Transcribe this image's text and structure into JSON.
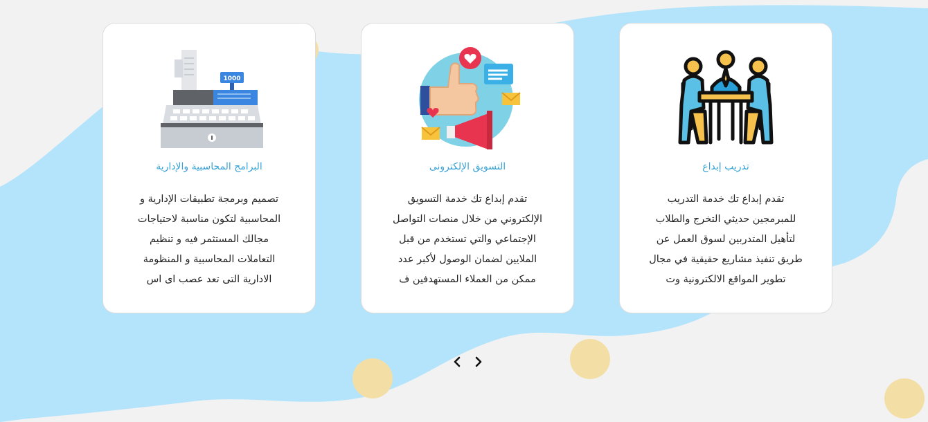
{
  "colors": {
    "background": "#f2f2f2",
    "blob": "#b3e4fb",
    "card": "#ffffff",
    "title": "#3aa3d6",
    "text": "#222222",
    "dot": "#f3dfa5"
  },
  "cards": [
    {
      "icon": "training-meeting-icon",
      "title": "تدريب إبداع",
      "lines": [
        "تقدم إبداع تك خدمة التدريب",
        "للمبرمجين حديثي التخرج والطلاب",
        "لتأهيل المتدربين لسوق العمل عن",
        "طريق تنفيذ مشاريع حقيقية في مجال",
        "تطوير المواقع الالكترونية وت"
      ]
    },
    {
      "icon": "digital-marketing-icon",
      "title": "التسويق الإلكترونى",
      "lines": [
        "تقدم إبداع تك خدمة التسويق",
        "الإلكتروني من خلال منصات التواصل",
        "الإجتماعي والتي تستخدم من قبل",
        "الملايين لضمان الوصول لأكبر عدد",
        "ممكن من العملاء المستهدفين ف"
      ]
    },
    {
      "icon": "cash-register-icon",
      "title": "البرامج المحاسبية والإدارية",
      "lines": [
        "تصميم وبرمجة تطبيقات الإدارية و",
        "المحاسبية لتكون مناسبة لاحتياجات",
        "مجالك المستثمر فيه و تنظيم",
        "التعاملات المحاسبية و المنظومة",
        "الادارية التى تعد عصب اى اس"
      ],
      "register_display": "1000"
    }
  ],
  "navigation": {
    "prev_icon": "chevron-left-icon",
    "next_icon": "chevron-right-icon"
  }
}
